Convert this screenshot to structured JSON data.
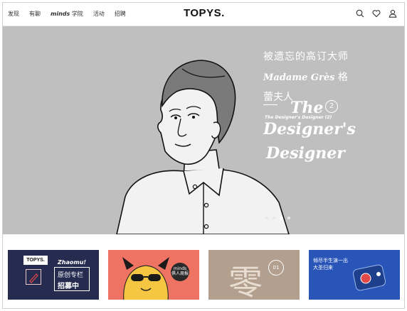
{
  "header": {
    "nav": [
      {
        "label": "发现"
      },
      {
        "label": "有聊"
      },
      {
        "label_italic": "minds",
        "label": "学院"
      },
      {
        "label": "活动"
      },
      {
        "label": "招聘"
      }
    ],
    "logo": "TOPYS.",
    "tools": [
      "search-icon",
      "heart-icon",
      "user-icon"
    ]
  },
  "hero": {
    "line1": "被遗忘的高订大师",
    "line2_en": "Madame Grès",
    "line2_cn": "格",
    "line3": "蕾夫人",
    "art_small": "The Designer's Designer (2)",
    "art_the": "The",
    "art_num": "2",
    "art_designers": "Designer's",
    "art_designer": "Designer",
    "colors": {
      "background": "#bfbfbf",
      "text": "#ffffff"
    },
    "carousel": {
      "count": 4,
      "active": 3
    }
  },
  "cards": [
    {
      "logo": "TOPYS.",
      "tag": "Zhaomu!",
      "line1": "原创专栏",
      "line2": "招募中",
      "color": "#262c50"
    },
    {
      "badge": "minds 俱人周报",
      "color": "#ef7363"
    },
    {
      "char": "零",
      "num": "01",
      "color": "#b29f8d"
    },
    {
      "line1": "倾尽半生演一出",
      "line2": "大圣归来",
      "color": "#2a55b8"
    }
  ]
}
